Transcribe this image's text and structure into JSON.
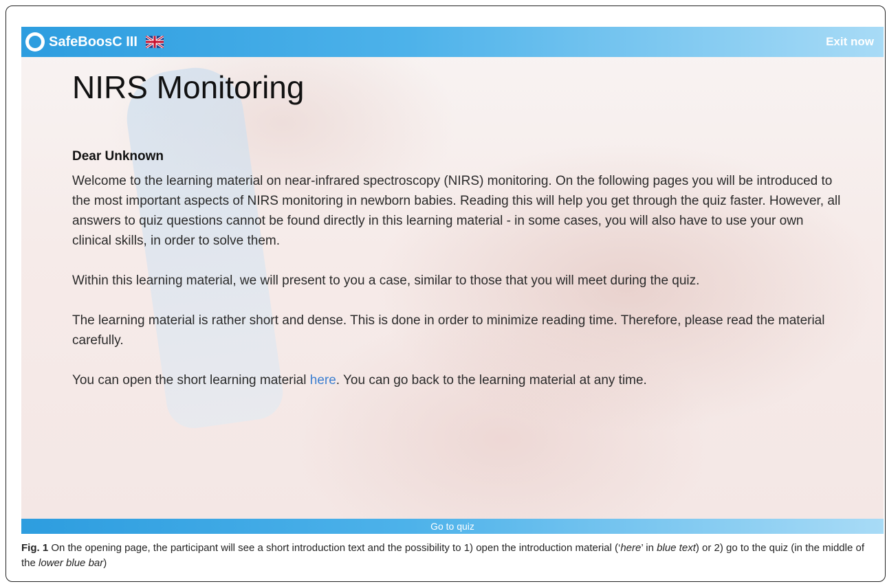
{
  "header": {
    "brand_name": "SafeBoosC III",
    "exit_label": "Exit now"
  },
  "main": {
    "title": "NIRS Monitoring",
    "greeting": "Dear Unknown",
    "para1": "Welcome to the learning material on near-infrared spectroscopy (NIRS) monitoring. On the following pages you will be introduced to the most important aspects of NIRS monitoring in newborn babies. Reading this will help you get through the quiz faster. However, all answers to quiz questions cannot be found directly in this learning material - in some cases, you will also have to use your own clinical skills, in order to solve them.",
    "para2": "Within this learning material, we will present to you a case, similar to those that you will meet during the quiz.",
    "para3": "The learning material is rather short and dense. This is done in order to minimize reading time. Therefore, please read the material carefully.",
    "para4_before": "You can open the short learning material ",
    "para4_link": "here",
    "para4_after": ". You can go back to the learning material at any time."
  },
  "footer": {
    "go_to_quiz": "Go to quiz"
  },
  "caption": {
    "label": "Fig. 1",
    "text_1": " On the opening page, the participant will see a short introduction text and the possibility to 1) open the introduction material (‘",
    "here_italic": "here",
    "text_2": "’ in ",
    "blue_text_italic": "blue text",
    "text_3": ") or 2) go to the quiz (in the middle of the ",
    "lower_bar_italic": "lower blue bar",
    "text_4": ")"
  },
  "colors": {
    "bar_start": "#2d9ddf",
    "bar_end": "#a8dbf6",
    "link": "#3c7fd0"
  },
  "icons": [
    "logo-icon",
    "uk-flag-icon"
  ]
}
